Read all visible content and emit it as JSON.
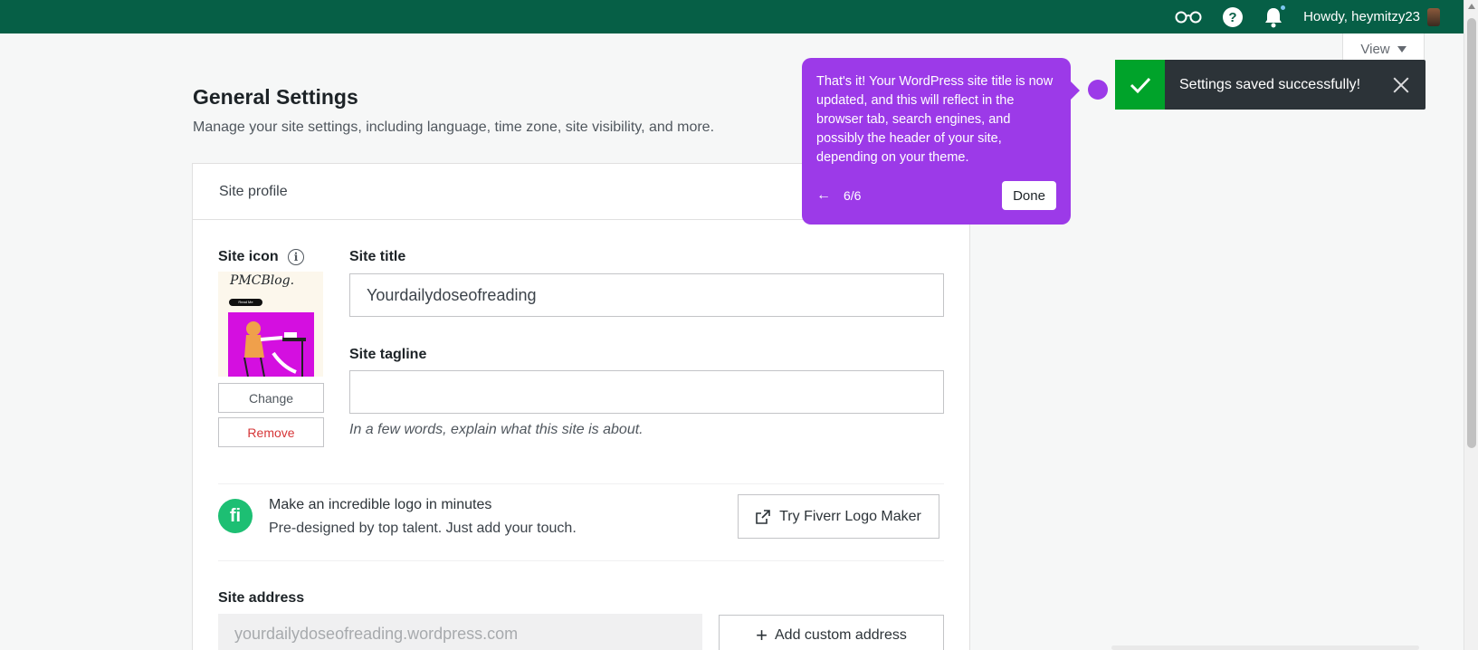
{
  "adminbar": {
    "howdy": "Howdy, heymitzy23",
    "icons": [
      "reader-glasses-icon",
      "help-icon",
      "notifications-bell-icon"
    ]
  },
  "view_button": {
    "label": "View"
  },
  "page": {
    "title": "General Settings",
    "subtitle": "Manage your site settings, including language, time zone, site visibility, and more."
  },
  "card": {
    "header": "Site profile",
    "site_icon": {
      "label": "Site icon",
      "image_text": "PMCBlog.",
      "image_pill": "Read Me",
      "change_label": "Change",
      "remove_label": "Remove"
    },
    "site_title": {
      "label": "Site title",
      "value": "Yourdailydoseofreading"
    },
    "site_tagline": {
      "label": "Site tagline",
      "value": "",
      "hint": "In a few words, explain what this site is about."
    },
    "promo": {
      "icon_text": "fi",
      "title": "Make an incredible logo in minutes",
      "subtitle": "Pre-designed by top talent. Just add your touch.",
      "button": "Try Fiverr Logo Maker"
    },
    "site_address": {
      "label": "Site address",
      "value": "yourdailydoseofreading.wordpress.com",
      "button": "Add custom address"
    }
  },
  "tour": {
    "text": "That's it! Your WordPress site title is now updated, and this will reflect in the browser tab, search engines, and possibly the header of your site, depending on your theme.",
    "back": "←",
    "step": "6/6",
    "done": "Done"
  },
  "notice": {
    "text": "Settings saved successfully!"
  },
  "colors": {
    "adminbar": "#065f46",
    "tour": "#9c3ae8",
    "success": "#00a32a",
    "notice_bg": "#2c3338"
  }
}
